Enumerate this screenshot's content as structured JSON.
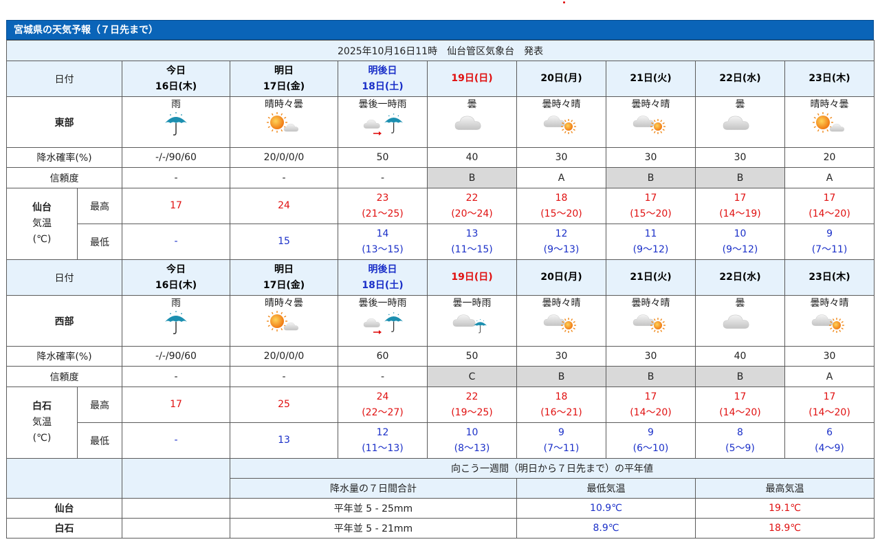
{
  "title": "宮城県の天気予報（７日先まで）",
  "issued": "2025年10月16日11時　仙台管区気象台　発表",
  "days": [
    {
      "l1": "今日",
      "l2": "16日(木)",
      "color": "#000000"
    },
    {
      "l1": "明日",
      "l2": "17日(金)",
      "color": "#000000"
    },
    {
      "l1": "明後日",
      "l2": "18日(土)",
      "color": "#1a2fc8"
    },
    {
      "l1": "19日(日)",
      "l2": "",
      "color": "#e01010"
    },
    {
      "l1": "20日(月)",
      "l2": "",
      "color": "#000000"
    },
    {
      "l1": "21日(火)",
      "l2": "",
      "color": "#000000"
    },
    {
      "l1": "22日(水)",
      "l2": "",
      "color": "#000000"
    },
    {
      "l1": "23日(木)",
      "l2": "",
      "color": "#000000"
    }
  ],
  "labels": {
    "date": "日付",
    "pop": "降水確率(%)",
    "reliability": "信頼度",
    "temp_l1": "気温",
    "temp_l2": "(℃)",
    "max": "最高",
    "min": "最低"
  },
  "regions": [
    {
      "name": "東部",
      "city": "仙台",
      "weather": [
        {
          "text": "雨",
          "icon": "rain-umbrella-icon"
        },
        {
          "text": "晴時々曇",
          "icon": "sun-cloud-icon"
        },
        {
          "text": "曇後一時雨",
          "icon": "cloud-then-rain-icon"
        },
        {
          "text": "曇",
          "icon": "cloud-icon"
        },
        {
          "text": "曇時々晴",
          "icon": "cloud-sun-icon"
        },
        {
          "text": "曇時々晴",
          "icon": "cloud-sun-icon"
        },
        {
          "text": "曇",
          "icon": "cloud-icon"
        },
        {
          "text": "晴時々曇",
          "icon": "sun-cloud-icon"
        }
      ],
      "pop": [
        "-/-/90/60",
        "20/0/0/0",
        "50",
        "40",
        "30",
        "30",
        "30",
        "20"
      ],
      "reliability": [
        {
          "v": "-",
          "grey": false
        },
        {
          "v": "-",
          "grey": false
        },
        {
          "v": "-",
          "grey": false
        },
        {
          "v": "B",
          "grey": true
        },
        {
          "v": "A",
          "grey": false
        },
        {
          "v": "B",
          "grey": true
        },
        {
          "v": "B",
          "grey": true
        },
        {
          "v": "A",
          "grey": false
        }
      ],
      "max": [
        {
          "v": "17",
          "r": ""
        },
        {
          "v": "24",
          "r": ""
        },
        {
          "v": "23",
          "r": "(21〜25)"
        },
        {
          "v": "22",
          "r": "(20〜24)"
        },
        {
          "v": "18",
          "r": "(15〜20)"
        },
        {
          "v": "17",
          "r": "(15〜20)"
        },
        {
          "v": "17",
          "r": "(14〜19)"
        },
        {
          "v": "17",
          "r": "(14〜20)"
        }
      ],
      "min": [
        {
          "v": "-",
          "r": ""
        },
        {
          "v": "15",
          "r": ""
        },
        {
          "v": "14",
          "r": "(13〜15)"
        },
        {
          "v": "13",
          "r": "(11〜15)"
        },
        {
          "v": "12",
          "r": "(9〜13)"
        },
        {
          "v": "11",
          "r": "(9〜12)"
        },
        {
          "v": "10",
          "r": "(9〜12)"
        },
        {
          "v": "9",
          "r": "(7〜11)"
        }
      ]
    },
    {
      "name": "西部",
      "city": "白石",
      "weather": [
        {
          "text": "雨",
          "icon": "rain-umbrella-icon"
        },
        {
          "text": "晴時々曇",
          "icon": "sun-cloud-icon"
        },
        {
          "text": "曇後一時雨",
          "icon": "cloud-then-rain-icon"
        },
        {
          "text": "曇一時雨",
          "icon": "cloud-rain-icon"
        },
        {
          "text": "曇時々晴",
          "icon": "cloud-sun-icon"
        },
        {
          "text": "曇時々晴",
          "icon": "cloud-sun-icon"
        },
        {
          "text": "曇",
          "icon": "cloud-icon"
        },
        {
          "text": "曇時々晴",
          "icon": "cloud-sun-icon"
        }
      ],
      "pop": [
        "-/-/90/60",
        "20/0/0/0",
        "60",
        "50",
        "30",
        "30",
        "40",
        "30"
      ],
      "reliability": [
        {
          "v": "-",
          "grey": false
        },
        {
          "v": "-",
          "grey": false
        },
        {
          "v": "-",
          "grey": false
        },
        {
          "v": "C",
          "grey": true
        },
        {
          "v": "B",
          "grey": true
        },
        {
          "v": "B",
          "grey": true
        },
        {
          "v": "B",
          "grey": true
        },
        {
          "v": "A",
          "grey": false
        }
      ],
      "max": [
        {
          "v": "17",
          "r": ""
        },
        {
          "v": "25",
          "r": ""
        },
        {
          "v": "24",
          "r": "(22〜27)"
        },
        {
          "v": "22",
          "r": "(19〜25)"
        },
        {
          "v": "18",
          "r": "(16〜21)"
        },
        {
          "v": "17",
          "r": "(14〜20)"
        },
        {
          "v": "17",
          "r": "(14〜20)"
        },
        {
          "v": "17",
          "r": "(14〜20)"
        }
      ],
      "min": [
        {
          "v": "-",
          "r": ""
        },
        {
          "v": "13",
          "r": ""
        },
        {
          "v": "12",
          "r": "(11〜13)"
        },
        {
          "v": "10",
          "r": "(8〜13)"
        },
        {
          "v": "9",
          "r": "(7〜11)"
        },
        {
          "v": "9",
          "r": "(6〜10)"
        },
        {
          "v": "8",
          "r": "(5〜9)"
        },
        {
          "v": "6",
          "r": "(4〜9)"
        }
      ]
    }
  ],
  "normals": {
    "header": "向こう一週間（明日から７日先まで）の平年値",
    "cols": [
      "降水量の７日間合計",
      "最低気温",
      "最高気温"
    ],
    "rows": [
      {
        "city": "仙台",
        "precip": "平年並 5 - 25mm",
        "min": "10.9℃",
        "max": "19.1℃"
      },
      {
        "city": "白石",
        "precip": "平年並 5 - 21mm",
        "min": "8.9℃",
        "max": "18.9℃"
      }
    ]
  },
  "colors": {
    "title_bar": "#0a64b8",
    "header_bg": "#e6f2fc",
    "reliability_grey": "#d9d9d9",
    "max_temp": "#e01010",
    "min_temp": "#1a2fc8"
  }
}
